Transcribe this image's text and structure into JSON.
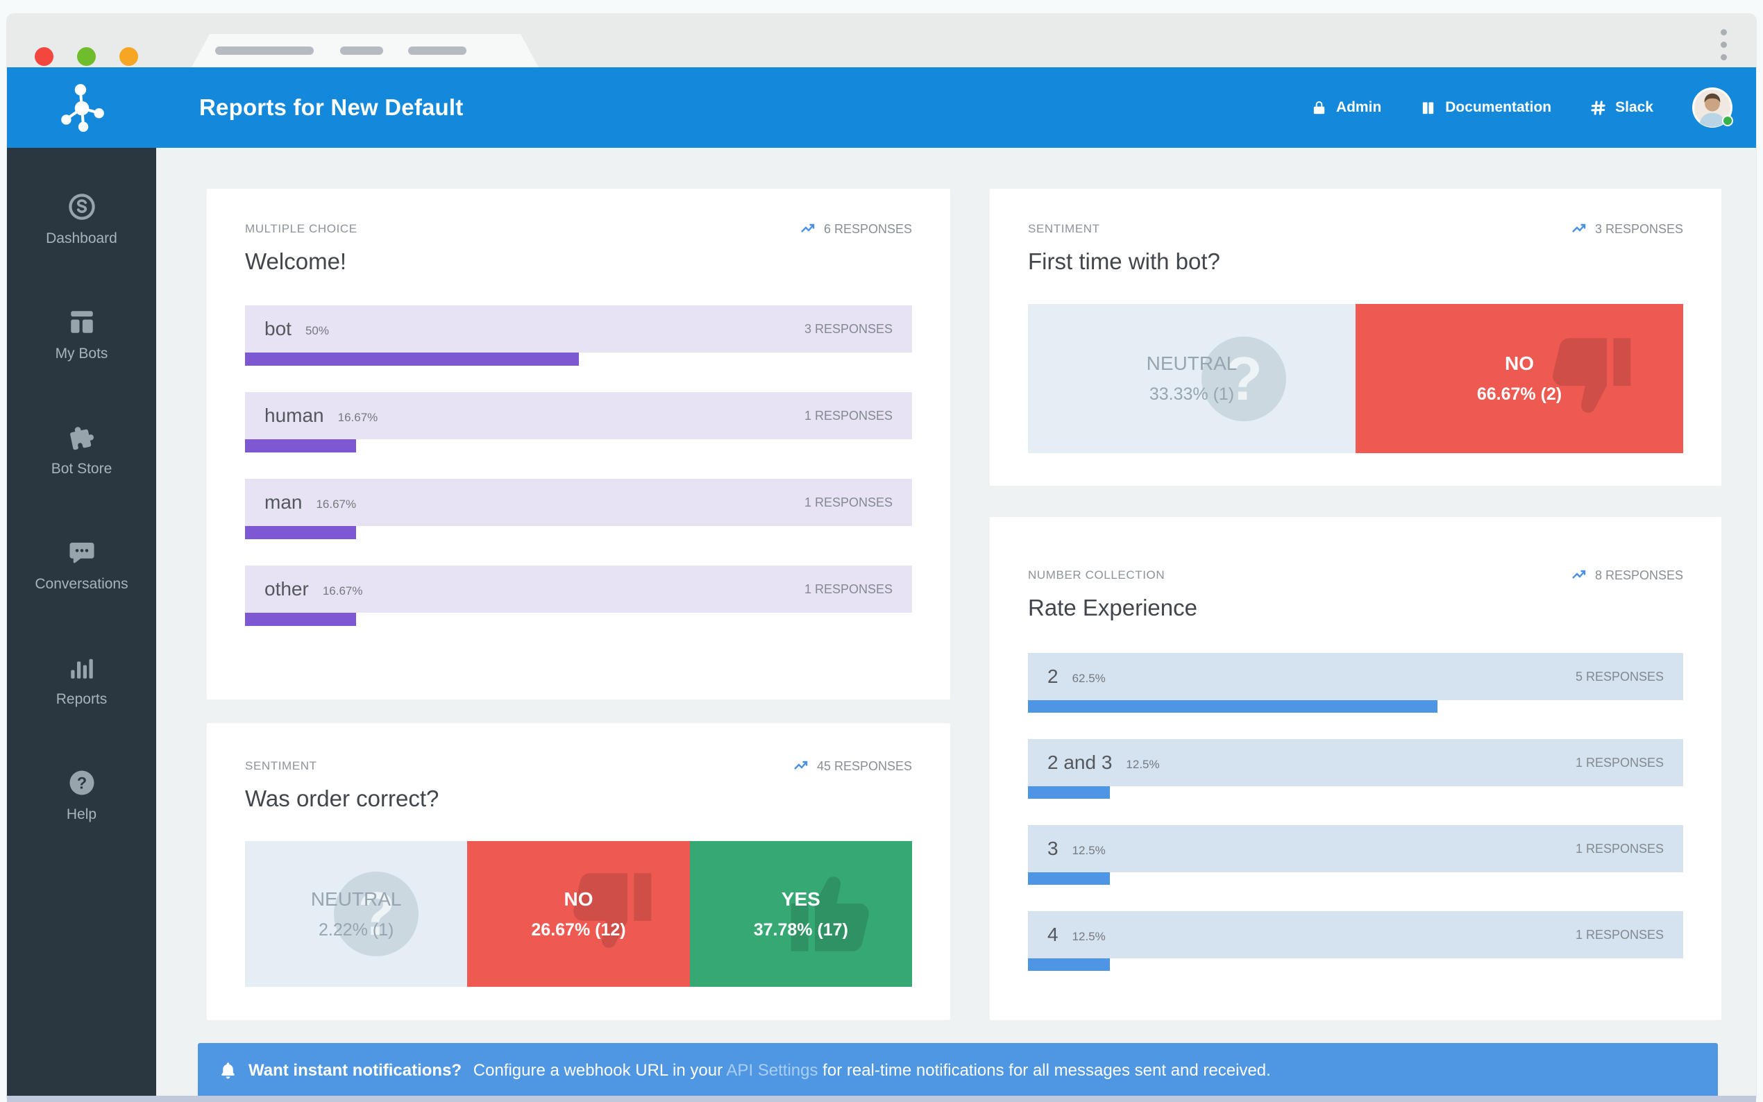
{
  "colors": {
    "header_blue": "#1489dc",
    "notification_blue": "#4f97e3",
    "bar_blue": "#4e96e5",
    "bar_purple": "#7e57d2",
    "row_lavender": "#e7e2f4",
    "row_lightblue": "#d5e2ef",
    "sentiment_neutral": "#e4eef4",
    "sentiment_negative": "#ee5a52",
    "sentiment_positive": "#36a873",
    "sidebar_dark": "#2b3740"
  },
  "header": {
    "title": "Reports for New Default",
    "nav": {
      "admin": "Admin",
      "documentation": "Documentation",
      "slack": "Slack"
    }
  },
  "sidebar": {
    "items": [
      {
        "label": "Dashboard"
      },
      {
        "label": "My Bots"
      },
      {
        "label": "Bot Store"
      },
      {
        "label": "Conversations"
      },
      {
        "label": "Reports"
      },
      {
        "label": "Help"
      }
    ]
  },
  "cards": {
    "welcome": {
      "category": "MULTIPLE CHOICE",
      "title": "Welcome!",
      "responses": "6 RESPONSES",
      "rows": [
        {
          "label": "bot",
          "pct": "50%",
          "width": 50,
          "responses": "3 RESPONSES"
        },
        {
          "label": "human",
          "pct": "16.67%",
          "width": 16.67,
          "responses": "1 RESPONSES"
        },
        {
          "label": "man",
          "pct": "16.67%",
          "width": 16.67,
          "responses": "1 RESPONSES"
        },
        {
          "label": "other",
          "pct": "16.67%",
          "width": 16.67,
          "responses": "1 RESPONSES"
        }
      ]
    },
    "order_correct": {
      "category": "SENTIMENT",
      "title": "Was order correct?",
      "responses": "45 RESPONSES",
      "segments": [
        {
          "label": "NEUTRAL",
          "value": "2.22% (1)"
        },
        {
          "label": "NO",
          "value": "26.67% (12)"
        },
        {
          "label": "YES",
          "value": "37.78% (17)"
        }
      ]
    },
    "first_time": {
      "category": "SENTIMENT",
      "title": "First time with bot?",
      "responses": "3 RESPONSES",
      "segments": [
        {
          "label": "NEUTRAL",
          "value": "33.33% (1)"
        },
        {
          "label": "NO",
          "value": "66.67% (2)"
        }
      ]
    },
    "rate_experience": {
      "category": "NUMBER COLLECTION",
      "title": "Rate Experience",
      "responses": "8 RESPONSES",
      "rows": [
        {
          "label": "2",
          "pct": "62.5%",
          "width": 62.5,
          "responses": "5 RESPONSES"
        },
        {
          "label": "2 and 3",
          "pct": "12.5%",
          "width": 12.5,
          "responses": "1 RESPONSES"
        },
        {
          "label": "3",
          "pct": "12.5%",
          "width": 12.5,
          "responses": "1 RESPONSES"
        },
        {
          "label": "4",
          "pct": "12.5%",
          "width": 12.5,
          "responses": "1 RESPONSES"
        }
      ]
    }
  },
  "notification": {
    "bold": "Want instant notifications?",
    "pre_link": "Configure a webhook URL in your",
    "link": "API Settings",
    "post_link": "for real-time notifications for all messages sent and received."
  }
}
